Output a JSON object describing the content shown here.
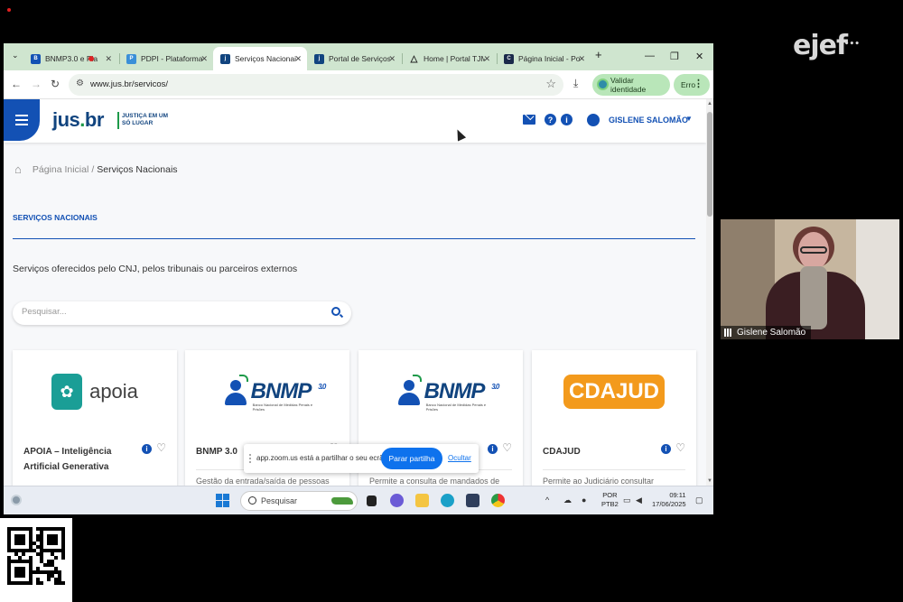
{
  "overlay": {
    "logo_text": "ejef",
    "logo_dots": "•••"
  },
  "browser": {
    "tabs": [
      {
        "label": "BNMP3.0 e Pla",
        "active": false
      },
      {
        "label": "PDPI - Plataforma",
        "active": false
      },
      {
        "label": "Serviços Nacionais",
        "active": true
      },
      {
        "label": "Portal de Serviços",
        "active": false
      },
      {
        "label": "Home | Portal TJM",
        "active": false
      },
      {
        "label": "Página Inicial - Por",
        "active": false
      }
    ],
    "new_tab": "+",
    "url": "www.jus.br/servicos/",
    "validate_identity": "Validar identidade",
    "error_button": "Erro"
  },
  "site": {
    "logo": "jus",
    "logo_dot": ".",
    "logo_tld": "br",
    "tagline": "JUSTIÇA EM UM SÓ LUGAR",
    "user_name": "GISLENE SALOMÃO",
    "breadcrumb_home": "Página Inicial",
    "breadcrumb_separator": "/",
    "breadcrumb_current": "Serviços Nacionais",
    "section_title": "SERVIÇOS NACIONAIS",
    "description": "Serviços oferecidos pelo CNJ, pelos tribunais ou parceiros externos",
    "search_placeholder": "Pesquisar..."
  },
  "cards": [
    {
      "logo_text": "apoia",
      "title": "APOIA – Inteligência Artificial Generativa",
      "desc": ""
    },
    {
      "logo_text": "BNMP",
      "version": "3.0",
      "sub": "Banco Nacional de Medidas Penais e Prisões",
      "title": "BNMP 3.0",
      "desc": "Gestão da entrada/saída de pessoas"
    },
    {
      "logo_text": "BNMP",
      "version": "3.0",
      "sub": "Banco Nacional de Medidas Penais e Prisões",
      "title": "",
      "desc": "Permite a consulta de mandados de"
    },
    {
      "logo_text": "CDAJUD",
      "title": "CDAJUD",
      "desc": "Permite ao Judiciário consultar"
    }
  ],
  "zoom": {
    "message": "app.zoom.us está a partilhar o seu ecrã.",
    "stop_button": "Parar partilha",
    "hide_link": "Ocultar"
  },
  "taskbar": {
    "search_label": "Pesquisar",
    "lang_line1": "POR",
    "lang_line2": "PTB2",
    "time": "09:11",
    "date": "17/06/2025"
  },
  "participant": {
    "name": "Gislene Salomão"
  },
  "colors": {
    "primary": "#1351b4",
    "brand_green": "#1e9a4a",
    "tab_strip": "#cfe5cf",
    "cdajud": "#f39a1c",
    "zoom_blue": "#0e72ed"
  }
}
